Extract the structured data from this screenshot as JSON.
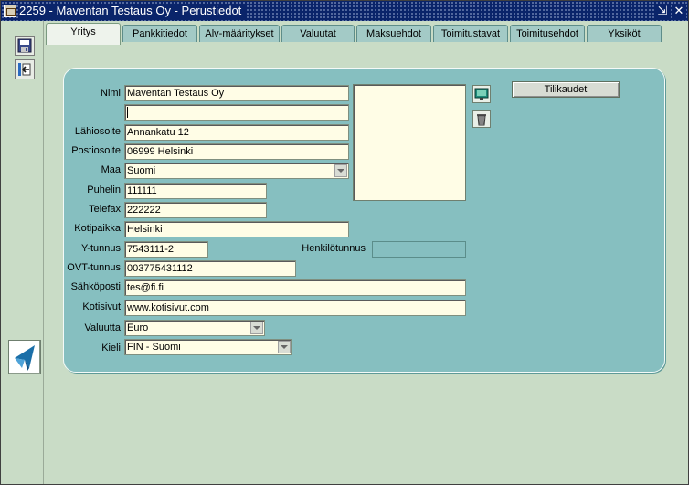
{
  "window": {
    "title": "2259 - Maventan Testaus Oy - Perustiedot",
    "minimize_glyph": "⇲",
    "close_glyph": "✕"
  },
  "toolbar": {
    "save_icon": "save-icon",
    "exit_icon": "exit-icon",
    "logo_icon": "maventa-logo-icon"
  },
  "tabs": [
    {
      "label": "Yritys",
      "active": true
    },
    {
      "label": "Pankkitiedot",
      "active": false
    },
    {
      "label": "Alv-määritykset",
      "active": false
    },
    {
      "label": "Valuutat",
      "active": false
    },
    {
      "label": "Maksuehdot",
      "active": false
    },
    {
      "label": "Toimitustavat",
      "active": false
    },
    {
      "label": "Toimitusehdot",
      "active": false
    },
    {
      "label": "Yksiköt",
      "active": false
    }
  ],
  "form": {
    "nimi": {
      "label": "Nimi",
      "value": "Maventan Testaus Oy"
    },
    "nimi2": {
      "value": ""
    },
    "lahiosoite": {
      "label": "Lähiosoite",
      "value": "Annankatu 12"
    },
    "postiosoite": {
      "label": "Postiosoite",
      "value": "06999 Helsinki"
    },
    "maa": {
      "label": "Maa",
      "value": "Suomi"
    },
    "puhelin": {
      "label": "Puhelin",
      "value": "111111"
    },
    "telefax": {
      "label": "Telefax",
      "value": "222222"
    },
    "kotipaikka": {
      "label": "Kotipaikka",
      "value": "Helsinki"
    },
    "ytunnus": {
      "label": "Y-tunnus",
      "value": "7543111-2"
    },
    "henkilotunnus": {
      "label": "Henkilötunnus",
      "value": ""
    },
    "ovt": {
      "label": "OVT-tunnus",
      "value": "003775431112"
    },
    "sahkoposti": {
      "label": "Sähköposti",
      "value": "tes@fi.fi"
    },
    "kotisivut": {
      "label": "Kotisivut",
      "value": "www.kotisivut.com"
    },
    "valuutta": {
      "label": "Valuutta",
      "value": "Euro"
    },
    "kieli": {
      "label": "Kieli",
      "value": "FIN - Suomi"
    }
  },
  "buttons": {
    "tilikaudet": "Tilikaudet",
    "image_icon": "image-icon",
    "delete_icon": "trash-icon"
  },
  "colors": {
    "panel": "#86bfc0",
    "field": "#fffde6",
    "titlebar": "#0a246a"
  }
}
